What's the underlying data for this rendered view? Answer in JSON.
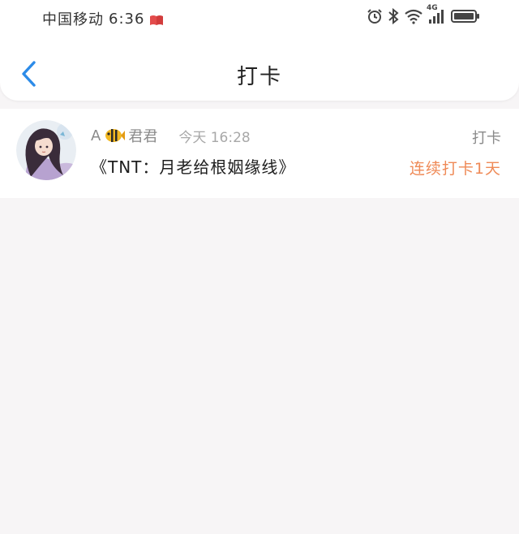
{
  "status_bar": {
    "carrier": "中国移动",
    "time": "6:36",
    "network": "4G",
    "icons": [
      "book-icon",
      "alarm-icon",
      "bluetooth-icon",
      "wifi-icon",
      "signal-icon",
      "battery-icon"
    ]
  },
  "nav": {
    "back_icon": "chevron-left-icon",
    "title": "打卡"
  },
  "checkin": {
    "user_prefix": "A",
    "user_name": "君君",
    "time": "今天 16:28",
    "title": "《TNT：月老给根姻缘线》",
    "type_label": "打卡",
    "streak": "连续打卡1天"
  },
  "colors": {
    "accent_blue": "#2c8be8",
    "streak_orange": "#ef8a57",
    "background": "#f7f5f6"
  }
}
